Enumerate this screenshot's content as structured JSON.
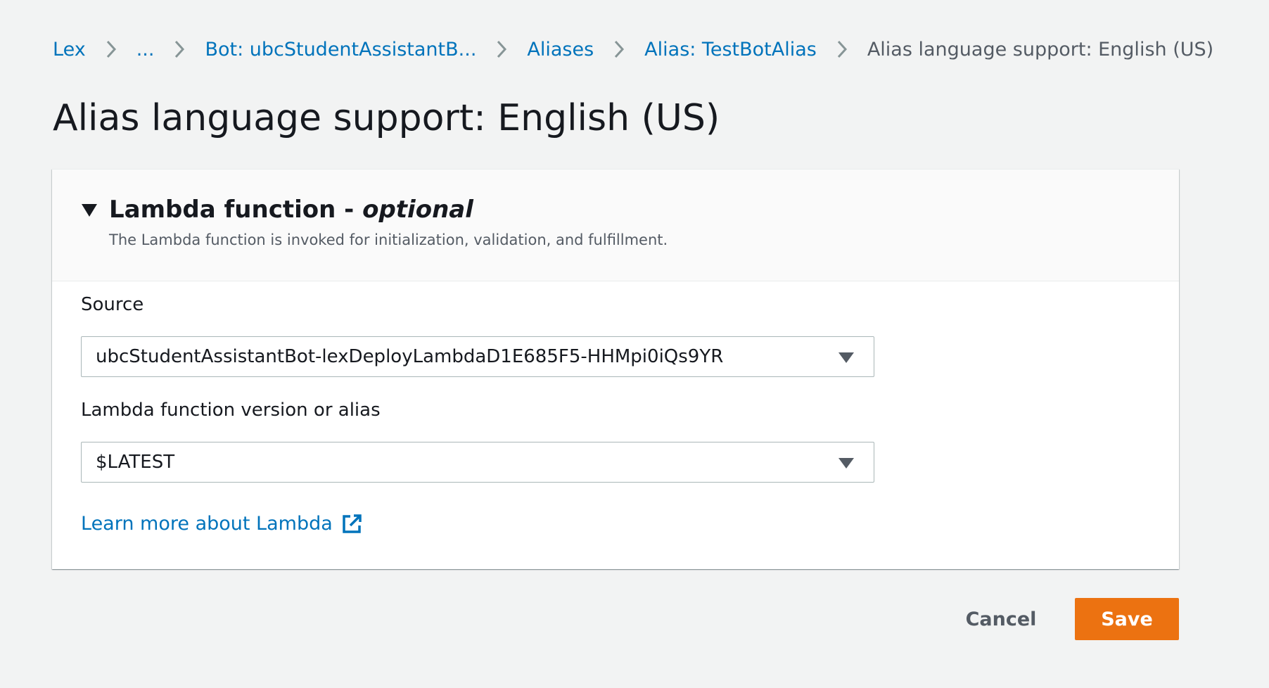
{
  "breadcrumb": {
    "items": [
      {
        "label": "Lex",
        "link": true
      },
      {
        "label": "...",
        "link": true
      },
      {
        "label": "Bot: ubcStudentAssistantB...",
        "link": true
      },
      {
        "label": "Aliases",
        "link": true
      },
      {
        "label": "Alias: TestBotAlias",
        "link": true
      },
      {
        "label": "Alias language support: English (US)",
        "link": false
      }
    ],
    "separator_icon": "chevron-right-icon"
  },
  "page": {
    "title": "Alias language support: English (US)"
  },
  "lambda_panel": {
    "expanded": true,
    "toggle_icon": "caret-down-icon",
    "title": "Lambda function - ",
    "title_optional": "optional",
    "description": "The Lambda function is invoked for initialization, validation, and fulfillment.",
    "source": {
      "label": "Source",
      "value": "ubcStudentAssistantBot-lexDeployLambdaD1E685F5-HHMpi0iQs9YR",
      "icon": "caret-down-icon"
    },
    "version": {
      "label": "Lambda function version or alias",
      "value": "$LATEST",
      "icon": "caret-down-icon"
    },
    "learn_more": {
      "label": "Learn more about Lambda",
      "icon": "external-link-icon"
    }
  },
  "actions": {
    "cancel_label": "Cancel",
    "save_label": "Save"
  },
  "colors": {
    "link": "#0073bb",
    "primary_button": "#ec7211",
    "page_background": "#f2f3f3",
    "text": "#16191f",
    "muted_text": "#545b64"
  }
}
